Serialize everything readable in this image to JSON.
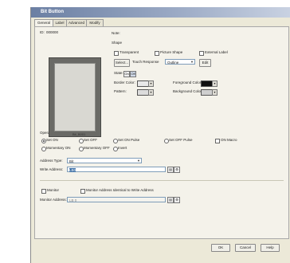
{
  "window": {
    "title": "Bit Button"
  },
  "tabs": [
    "General",
    "Label",
    "Advanced",
    "Modify"
  ],
  "header": {
    "id_label": "ID:",
    "id_value": "000000",
    "note_label": "Note:"
  },
  "shape": {
    "title": "Shape",
    "checkboxes": [
      "Transparent",
      "Picture Shape",
      "External Label"
    ],
    "select_button": "Select...",
    "type_label": "Touch Response",
    "type_value": "Outline",
    "edit_button": "Edit",
    "state_label": "State:",
    "state_buttons": [
      "On",
      "Off"
    ],
    "border_color_label": "Border Color:",
    "foreground_color_label": "Foreground Color:",
    "pattern_label": "Pattern:",
    "background_color_label": "Background Color:"
  },
  "preview": {
    "caption": "Bit_B001"
  },
  "operation": {
    "title": "Operation",
    "options": [
      {
        "label": "Set ON",
        "selected": true
      },
      {
        "label": "Set OFF",
        "selected": false
      },
      {
        "label": "Set ON Pulse",
        "selected": false
      },
      {
        "label": "Set OFF Pulse",
        "selected": false
      },
      {
        "label": "ON Macro",
        "selected": false
      },
      {
        "label": "Momentary ON",
        "selected": false
      },
      {
        "label": "Momentary OFF",
        "selected": false
      },
      {
        "label": "Invert",
        "selected": false
      }
    ]
  },
  "address": {
    "type_label": "Address Type:",
    "type_value": "Bit",
    "write_label": "Write Address:",
    "write_value": "LB0"
  },
  "monitor": {
    "monitor_label": "Monitor",
    "monitor_same_label": "Monitor Address Identical to Write Address",
    "address_label": "Monitor Address:",
    "address_value": "LB 0"
  },
  "footer": {
    "ok": "OK",
    "cancel": "Cancel",
    "help": "Help"
  }
}
